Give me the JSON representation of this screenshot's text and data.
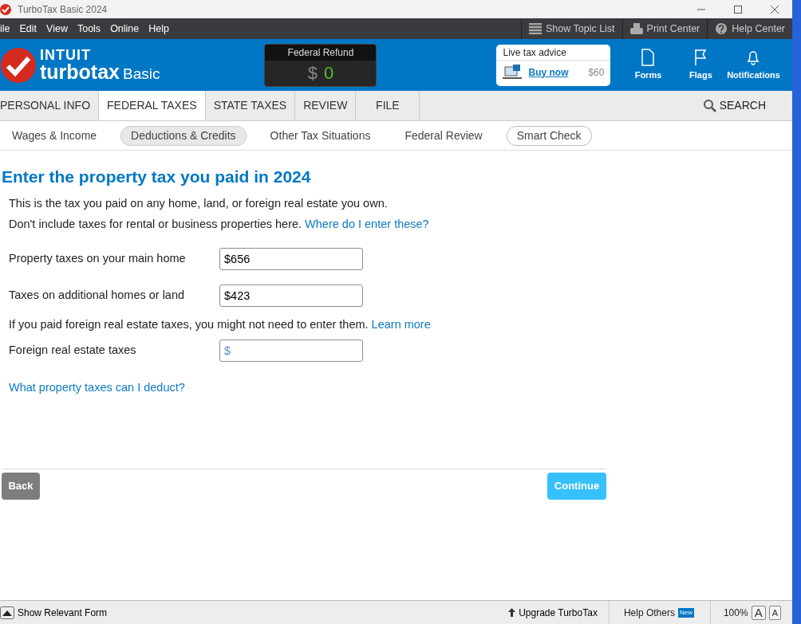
{
  "window": {
    "title": "TurboTax Basic 2024"
  },
  "menu": [
    "ile",
    "Edit",
    "View",
    "Tools",
    "Online",
    "Help"
  ],
  "toolbar": [
    {
      "label": "Show Topic List",
      "kind": "list"
    },
    {
      "label": "Print Center",
      "kind": "print"
    },
    {
      "label": "Help Center",
      "kind": "help"
    }
  ],
  "logo": {
    "brand": "INTUIT",
    "product": "turbotax",
    "edition": "Basic"
  },
  "refund": {
    "label": "Federal Refund",
    "currency": "$",
    "amount": "0"
  },
  "advice": {
    "title": "Live tax advice",
    "link": "Buy now",
    "price": "$60"
  },
  "header_buttons": [
    {
      "label": "Forms",
      "kind": "forms"
    },
    {
      "label": "Flags",
      "kind": "flags"
    },
    {
      "label": "Notifications",
      "kind": "bell"
    }
  ],
  "tabs": [
    {
      "label": "PERSONAL INFO",
      "selected": false
    },
    {
      "label": "FEDERAL TAXES",
      "selected": true
    },
    {
      "label": "STATE TAXES",
      "selected": false
    },
    {
      "label": "REVIEW",
      "selected": false
    },
    {
      "label": "FILE",
      "selected": false
    }
  ],
  "search": "SEARCH",
  "subtabs": [
    {
      "label": "Wages & Income",
      "selected": false,
      "kind": "plain"
    },
    {
      "label": "Deductions & Credits",
      "selected": true,
      "kind": "plain"
    },
    {
      "label": "Other Tax Situations",
      "selected": false,
      "kind": "plain"
    },
    {
      "label": "Federal Review",
      "selected": false,
      "kind": "plain"
    },
    {
      "label": "Smart Check",
      "selected": false,
      "kind": "outlined"
    }
  ],
  "page": {
    "heading": "Enter the property tax you paid in 2024",
    "intro": "This is the tax you paid on any home, land, or foreign real estate you own.",
    "note": "Don't include taxes for rental or business properties here.",
    "note_link": "Where do I enter these?",
    "fields": [
      {
        "label": "Property taxes on your main home",
        "value": "$656"
      },
      {
        "label": "Taxes on additional homes or land",
        "value": "$423"
      }
    ],
    "foreign_note": "If you paid foreign real estate taxes, you might not need to enter them.",
    "foreign_link": "Learn more",
    "foreign_field": {
      "label": "Foreign real estate taxes",
      "placeholder": "$"
    },
    "help_link": "What property taxes can I deduct?",
    "back": "Back",
    "continue": "Continue"
  },
  "status_bar": {
    "form_toggle": "Show Relevant Form",
    "upgrade": "Upgrade TurboTax",
    "help_others": "Help Others",
    "new_badge": "New",
    "zoom": "100%",
    "font_buttons": [
      "A",
      "A"
    ]
  }
}
